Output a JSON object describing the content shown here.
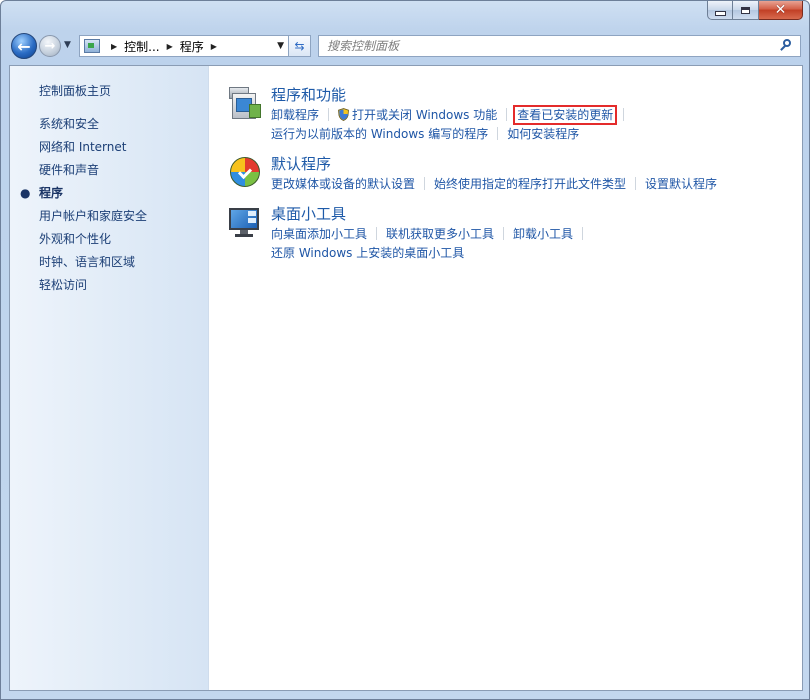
{
  "window": {
    "colors": {
      "accent": "#1e5aa8",
      "link": "#1f56a6",
      "highlight": "#e42b2b"
    }
  },
  "nav": {
    "breadcrumbs": [
      "控制...",
      "程序"
    ],
    "search_placeholder": "搜索控制面板"
  },
  "sidebar": {
    "home": "控制面板主页",
    "items": [
      {
        "label": "系统和安全"
      },
      {
        "label": "网络和 Internet"
      },
      {
        "label": "硬件和声音"
      },
      {
        "label": "程序",
        "current": true
      },
      {
        "label": "用户帐户和家庭安全"
      },
      {
        "label": "外观和个性化"
      },
      {
        "label": "时钟、语言和区域"
      },
      {
        "label": "轻松访问"
      }
    ]
  },
  "categories": [
    {
      "title": "程序和功能",
      "icon": "programs-icon",
      "links": [
        "卸载程序",
        "打开或关闭 Windows 功能",
        "查看已安装的更新",
        "运行为以前版本的 Windows 编写的程序",
        "如何安装程序"
      ]
    },
    {
      "title": "默认程序",
      "icon": "default-programs-icon",
      "links": [
        "更改媒体或设备的默认设置",
        "始终使用指定的程序打开此文件类型",
        "设置默认程序"
      ]
    },
    {
      "title": "桌面小工具",
      "icon": "desktop-gadgets-icon",
      "links": [
        "向桌面添加小工具",
        "联机获取更多小工具",
        "卸载小工具",
        "还原 Windows 上安装的桌面小工具"
      ]
    }
  ]
}
